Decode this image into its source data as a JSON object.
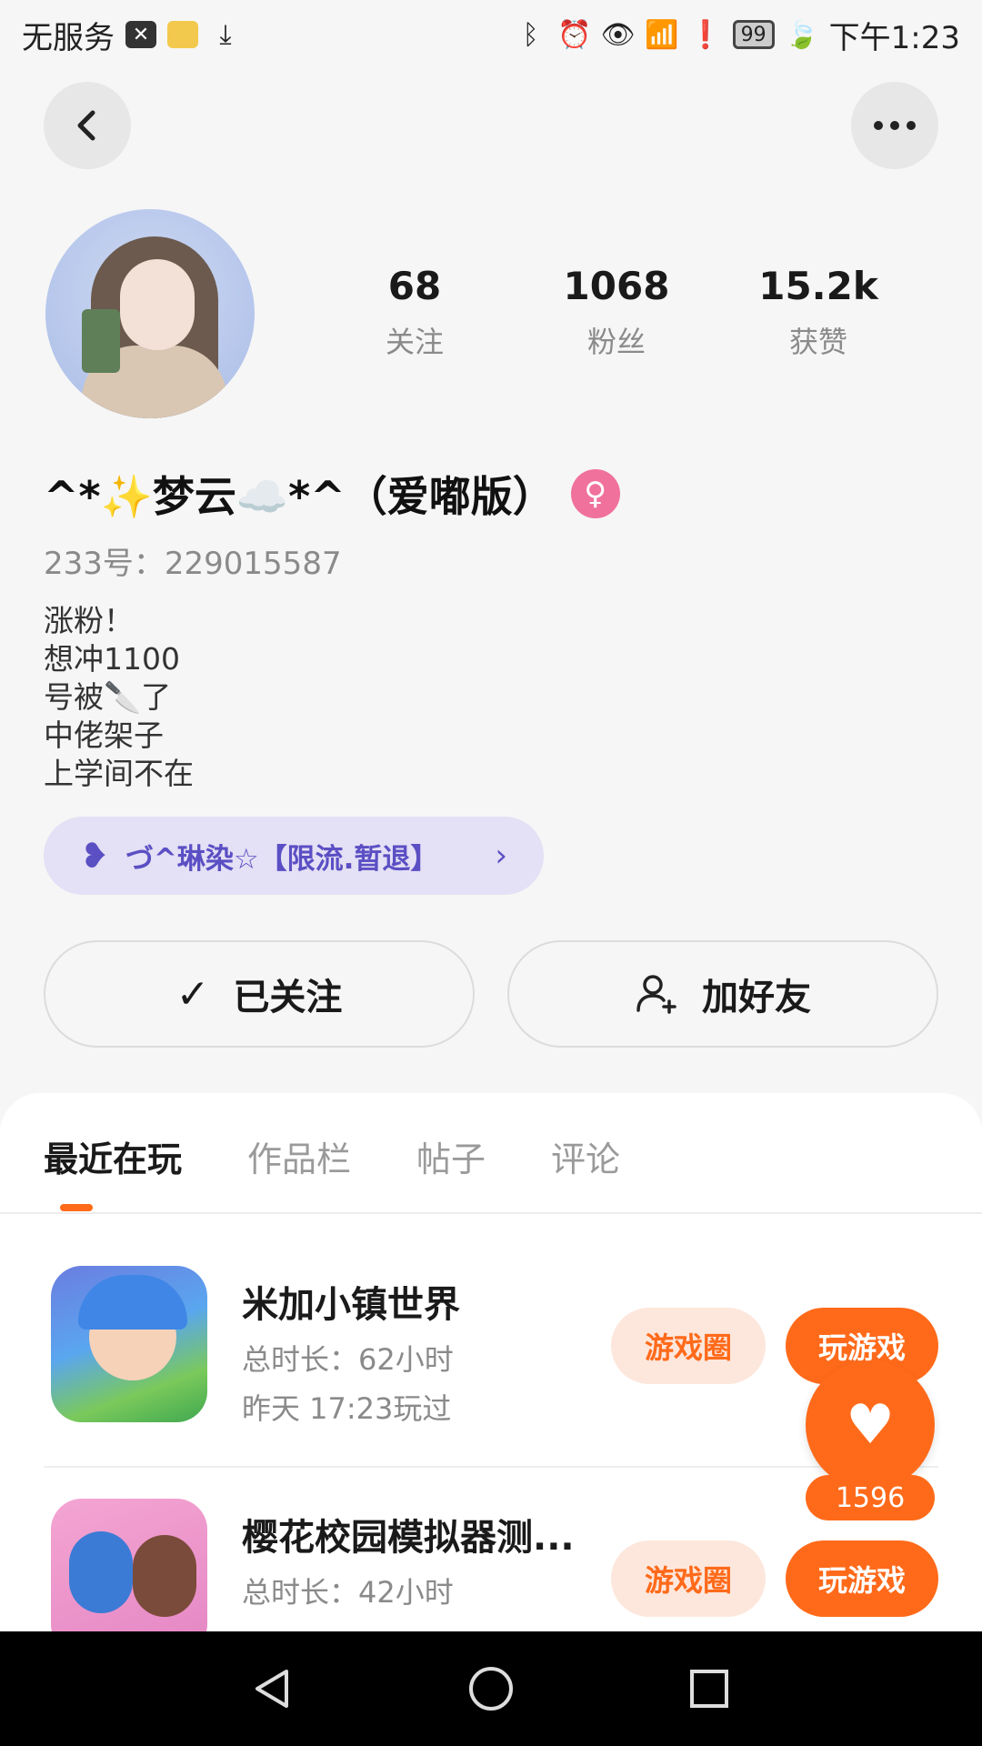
{
  "status_bar": {
    "carrier": "无服务",
    "battery": "99",
    "time": "下午1:23"
  },
  "profile": {
    "stats": [
      {
        "value": "68",
        "label": "关注"
      },
      {
        "value": "1068",
        "label": "粉丝"
      },
      {
        "value": "15.2k",
        "label": "获赞"
      }
    ],
    "name": "^*✨梦云☁️*^（爱嘟版）",
    "uid": "233号：229015587",
    "bio": [
      "涨粉！",
      "想冲1100",
      "号被🔪了",
      "中佬架子",
      "上学间不在"
    ],
    "group": "づ^琳染☆【限流.暂退】"
  },
  "actions": {
    "follow_label": "已关注",
    "friend_label": "加好友"
  },
  "tabs": [
    {
      "label": "最近在玩",
      "active": true
    },
    {
      "label": "作品栏",
      "active": false
    },
    {
      "label": "帖子",
      "active": false
    },
    {
      "label": "评论",
      "active": false
    }
  ],
  "games": [
    {
      "title": "米加小镇世界",
      "duration": "总时长：62小时",
      "last_played": "昨天 17:23玩过",
      "circle_label": "游戏圈",
      "play_label": "玩游戏"
    },
    {
      "title": "樱花校园模拟器测...",
      "duration": "总时长：42小时",
      "last_played": "",
      "circle_label": "游戏圈",
      "play_label": "玩游戏"
    }
  ],
  "like_count": "1596",
  "colors": {
    "accent": "#ff6a1a",
    "group_pill": "#e4e0f5",
    "gender_badge": "#f0719c"
  }
}
